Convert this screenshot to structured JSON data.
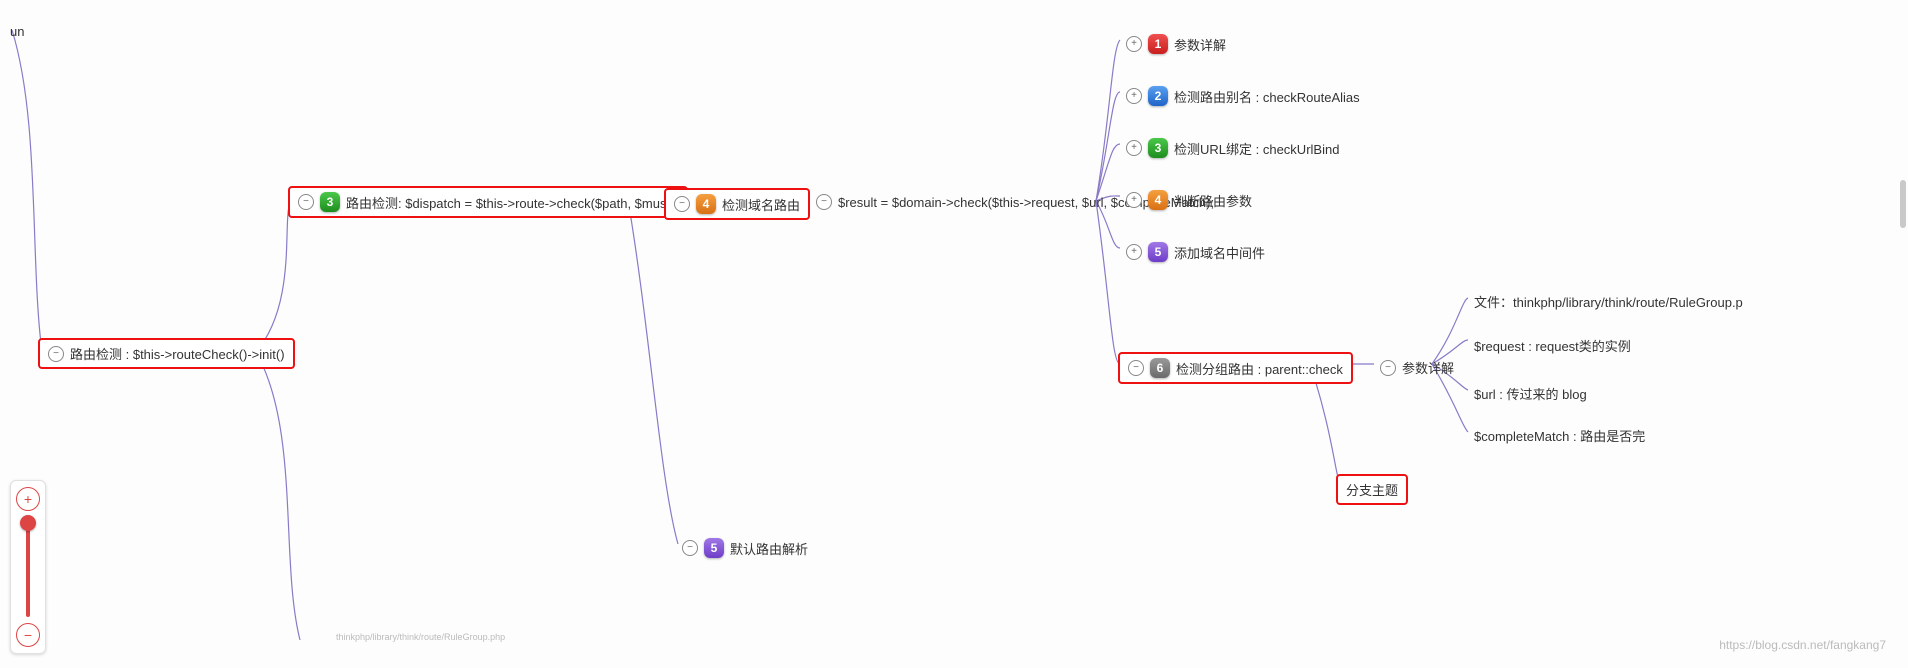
{
  "top_fragment": "un",
  "root": {
    "toggle": "−",
    "label": "路由检测 :   $this->routeCheck()->init()"
  },
  "n3": {
    "toggle": "−",
    "num": "3",
    "label": "路由检测:  $dispatch = $this->route->check($path, $must);"
  },
  "n4": {
    "toggle": "−",
    "num": "4",
    "label": "检测域名路由"
  },
  "mid_result": {
    "toggle": "−",
    "label": "$result = $domain->check($this->request, $url, $completeMatch);"
  },
  "n5b": {
    "toggle": "−",
    "num": "5",
    "label": "默认路由解析"
  },
  "children": {
    "c1": {
      "toggle": "+",
      "num": "1",
      "numClass": "n-red",
      "label": "参数详解"
    },
    "c2": {
      "toggle": "+",
      "num": "2",
      "numClass": "n-blue",
      "label": "检测路由别名 : checkRouteAlias"
    },
    "c3": {
      "toggle": "+",
      "num": "3",
      "numClass": "n-green",
      "label": "检测URL绑定 : checkUrlBind"
    },
    "c4": {
      "toggle": "+",
      "num": "4",
      "numClass": "n-orange",
      "label": "判断路由参数"
    },
    "c5": {
      "toggle": "+",
      "num": "5",
      "numClass": "n-purple",
      "label": "添加域名中间件"
    },
    "c6": {
      "toggle": "−",
      "num": "6",
      "numClass": "n-grey",
      "label": "检测分组路由 :   parent::check"
    }
  },
  "param_detail": {
    "toggle": "−",
    "label": "参数详解",
    "sub": {
      "a": "文件：thinkphp/library/think/route/RuleGroup.p",
      "b": "$request :   request类的实例",
      "c": "$url :  传过来的 blog",
      "d": "$completeMatch : 路由是否完"
    }
  },
  "branch_topic": "分支主题",
  "watermark": "https://blog.csdn.net/fangkang7",
  "mini_label": "thinkphp/library/think/route/RuleGroup.php",
  "zoom": {
    "plus": "+",
    "minus": "−"
  }
}
